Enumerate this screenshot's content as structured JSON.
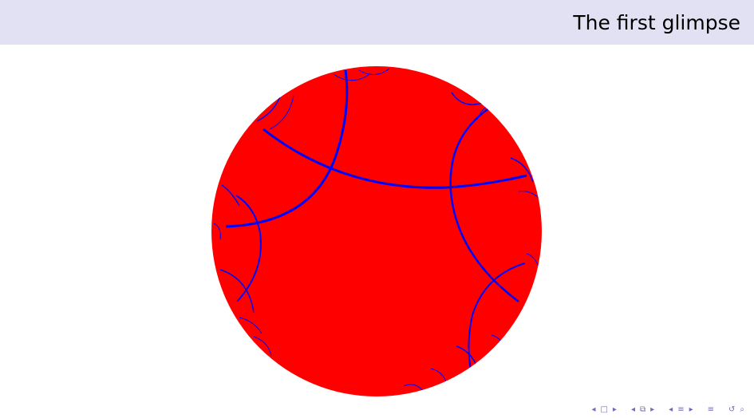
{
  "slide": {
    "title": "The first glimpse"
  },
  "diagram": {
    "type": "hyperbolic-tiling-poincare-disk",
    "colors": {
      "disk_fill": "#ff0000",
      "geodesics": "#0000ff",
      "header_bg": "#e1e1f3",
      "nav_icons": "#6e6eb3"
    }
  },
  "nav": {
    "icons": [
      "prev-frame-icon",
      "frame-icon",
      "next-frame-icon",
      "prev-subsection-icon",
      "subsection-icon",
      "next-subsection-icon",
      "prev-section-icon",
      "section-icon",
      "next-section-icon",
      "align-icon",
      "back-icon",
      "search-icon"
    ]
  }
}
